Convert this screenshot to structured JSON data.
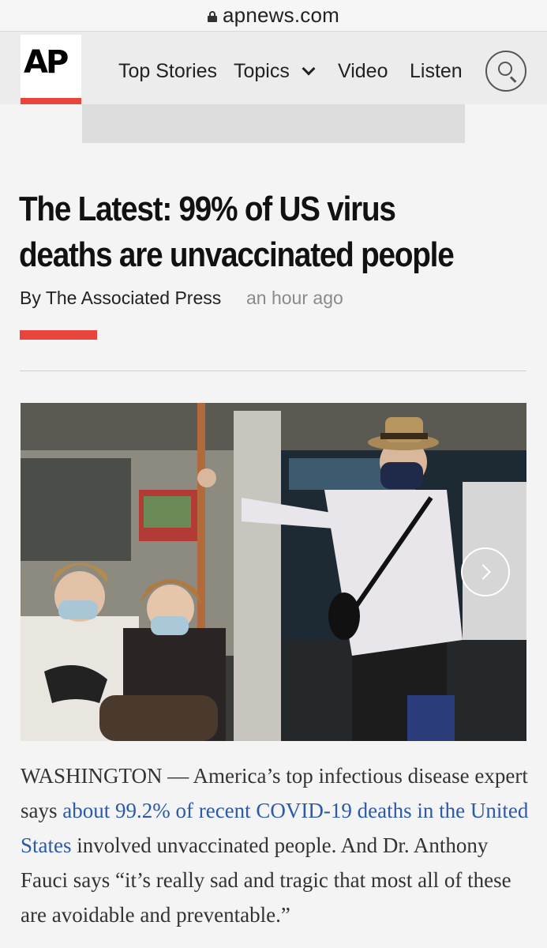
{
  "browser": {
    "domain": "apnews.com"
  },
  "header": {
    "logo_text": "AP",
    "nav": {
      "top_stories": "Top Stories",
      "topics": "Topics",
      "video": "Video",
      "listen": "Listen"
    }
  },
  "article": {
    "headline": "The Latest: 99% of US virus deaths are unvaccinated people",
    "byline": "By The Associated Press",
    "timestamp": "an hour ago",
    "body": {
      "lead": "WASHINGTON — America’s top infectious disease expert says ",
      "link": "about 99.2% of recent COVID-19 deaths in the United States",
      "rest": " involved unvaccinated people. And Dr. Anthony Fauci says “it’s really sad and tragic that most all of these are avoidable and preventable.”"
    }
  },
  "colors": {
    "ap_red": "#e8453c",
    "link_blue": "#2a5aa8"
  }
}
